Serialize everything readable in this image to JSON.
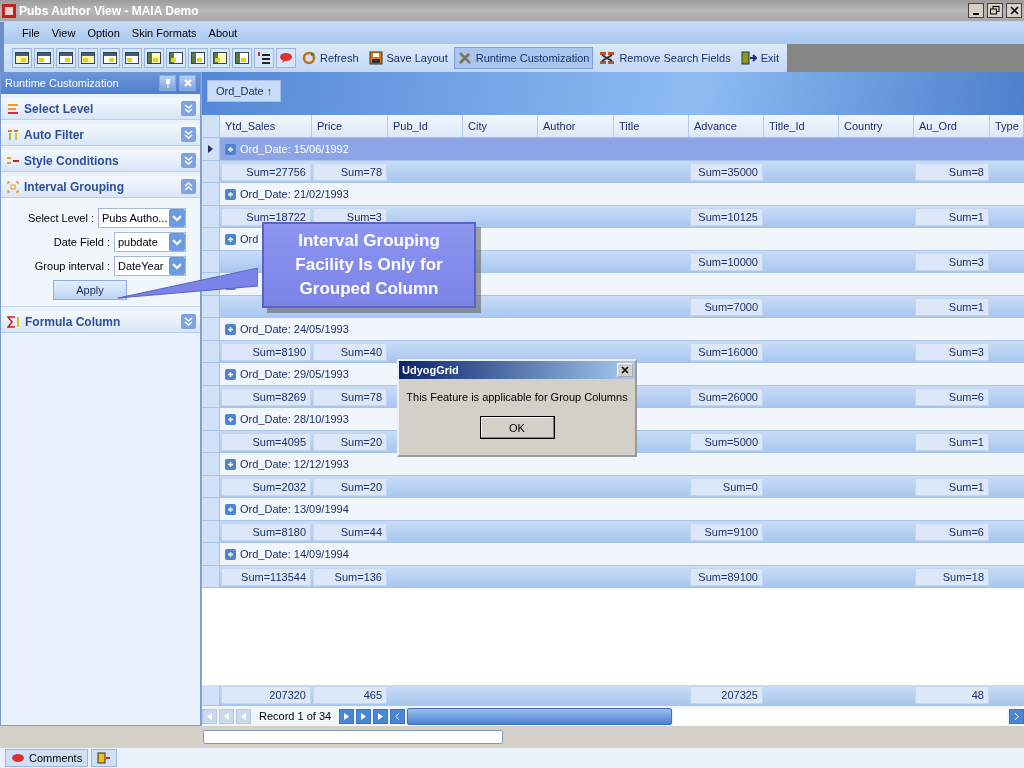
{
  "window": {
    "title": "Pubs Author View - MAIA Demo"
  },
  "menu": [
    "File",
    "View",
    "Option",
    "Skin Formats",
    "About"
  ],
  "toolbar": [
    {
      "label": "Refresh",
      "kind": "refresh",
      "selected": false
    },
    {
      "label": "Save Layout",
      "kind": "save",
      "selected": false
    },
    {
      "label": "Runtime Customization",
      "kind": "tools",
      "selected": true
    },
    {
      "label": "Remove Search Fields",
      "kind": "remove",
      "selected": false
    },
    {
      "label": "Exit",
      "kind": "exit",
      "selected": false
    }
  ],
  "panel": {
    "title": "Runtime Customization",
    "sections": [
      {
        "label": "Select Level",
        "kind": "level",
        "expanded": false
      },
      {
        "label": "Auto Filter",
        "kind": "filter",
        "expanded": false
      },
      {
        "label": "Style Conditions",
        "kind": "style",
        "expanded": false
      },
      {
        "label": "Interval Grouping",
        "kind": "interval",
        "expanded": true
      },
      {
        "label": "Formula Column",
        "kind": "formula",
        "expanded": false
      }
    ],
    "form": [
      {
        "label": "Select Level :",
        "value": "Pubs Autho..."
      },
      {
        "label": "Date Field :",
        "value": "pubdate"
      },
      {
        "label": "Group interval :",
        "value": "DateYear"
      }
    ],
    "apply": "Apply"
  },
  "grid": {
    "group_by": "Ord_Date ↑",
    "columns": [
      "Ytd_Sales",
      "Price",
      "Pub_Id",
      "City",
      "Author",
      "Title",
      "Advance",
      "Title_Id",
      "Country",
      "Au_Ord",
      "Type"
    ],
    "groups": [
      {
        "label": "Ord_Date: 15/06/1992",
        "selected": true,
        "sums": {
          "ytd_sales": "Sum=27756",
          "price": "Sum=78",
          "advance": "Sum=35000",
          "au_ord": "Sum=8"
        }
      },
      {
        "label": "Ord_Date: 21/02/1993",
        "selected": false,
        "sums": {
          "ytd_sales": "Sum=18722",
          "price": "Sum=3",
          "advance": "Sum=10125",
          "au_ord": "Sum=1"
        }
      },
      {
        "label": "Ord",
        "selected": false,
        "sums": {
          "advance": "Sum=10000",
          "au_ord": "Sum=3"
        }
      },
      {
        "selected": false,
        "sums": {
          "advance": "Sum=7000",
          "au_ord": "Sum=1"
        }
      },
      {
        "label": "Ord_Date: 24/05/1993",
        "selected": false,
        "sums": {
          "ytd_sales": "Sum=8190",
          "price": "Sum=40",
          "advance": "Sum=16000",
          "au_ord": "Sum=3"
        }
      },
      {
        "label": "Ord_Date: 29/05/1993",
        "selected": false,
        "sums": {
          "ytd_sales": "Sum=8269",
          "price": "Sum=78",
          "advance": "Sum=26000",
          "au_ord": "Sum=6"
        }
      },
      {
        "label": "Ord_Date: 28/10/1993",
        "selected": false,
        "sums": {
          "ytd_sales": "Sum=4095",
          "price": "Sum=20",
          "advance": "Sum=5000",
          "au_ord": "Sum=1"
        }
      },
      {
        "label": "Ord_Date: 12/12/1993",
        "selected": false,
        "sums": {
          "ytd_sales": "Sum=2032",
          "price": "Sum=20",
          "advance": "Sum=0",
          "au_ord": "Sum=1"
        }
      },
      {
        "label": "Ord_Date: 13/09/1994",
        "selected": false,
        "sums": {
          "ytd_sales": "Sum=8180",
          "price": "Sum=44",
          "advance": "Sum=9100",
          "au_ord": "Sum=6"
        }
      },
      {
        "label": "Ord_Date: 14/09/1994",
        "selected": false,
        "sums": {
          "ytd_sales": "Sum=113544",
          "price": "Sum=136",
          "advance": "Sum=89100",
          "au_ord": "Sum=18"
        }
      }
    ],
    "totals": {
      "ytd_sales": "207320",
      "price": "465",
      "advance": "207325",
      "au_ord": "48"
    },
    "record": "Record 1 of 34"
  },
  "callout": "Interval Grouping Facility Is Only for Grouped Column",
  "dialog": {
    "title": "UdyogGrid",
    "message": "This Feature is applicable for Group Columns",
    "button": "OK"
  },
  "taskbar": [
    {
      "label": "Comments"
    }
  ]
}
